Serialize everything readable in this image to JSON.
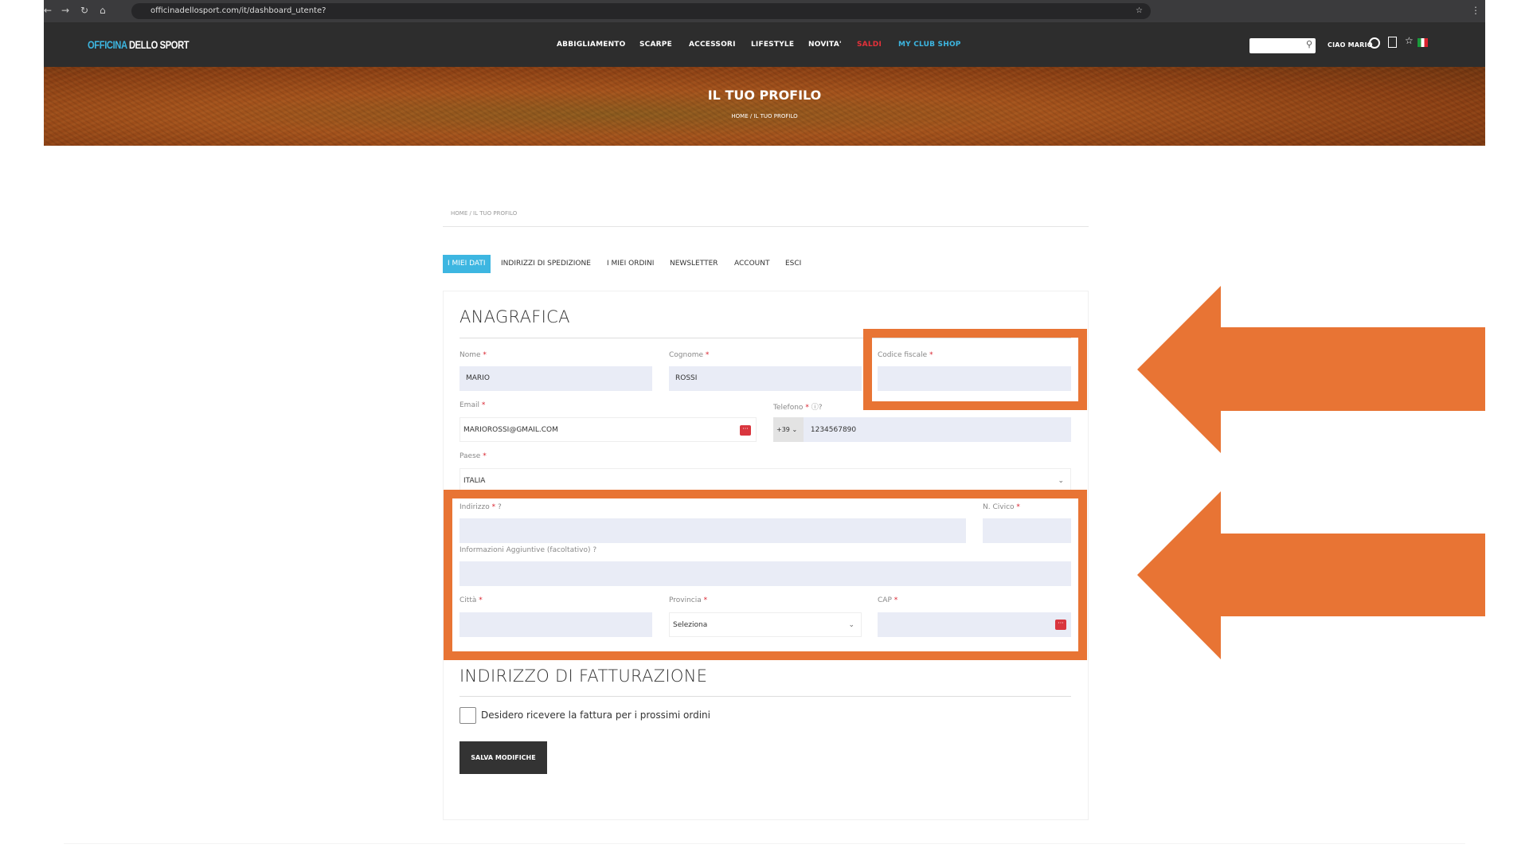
{
  "browser": {
    "url": "officinadellosport.com/it/dashboard_utente?"
  },
  "header": {
    "logo_part1": "OFFICINA",
    "logo_part2": "DELLO SPORT",
    "nav": [
      "ABBIGLIAMENTO",
      "SCARPE",
      "ACCESSORI",
      "LIFESTYLE",
      "NOVITA'",
      "SALDI",
      "MY CLUB SHOP"
    ],
    "greeting": "CIAO MARIO"
  },
  "banner": {
    "title": "IL TUO PROFILO",
    "breadcrumb": "HOME /  IL TUO PROFILO"
  },
  "breadcrumb": "HOME / IL TUO PROFILO",
  "tabs": [
    "I MIEI DATI",
    "INDIRIZZI DI SPEDIZIONE",
    "I MIEI ORDINI",
    "NEWSLETTER",
    "ACCOUNT",
    "ESCI"
  ],
  "form": {
    "section1": "ANAGRAFICA",
    "nome": {
      "label": "Nome",
      "value": "MARIO"
    },
    "cognome": {
      "label": "Cognome",
      "value": "ROSSI"
    },
    "codice_fiscale": {
      "label": "Codice fiscale",
      "value": ""
    },
    "email": {
      "label": "Email",
      "value": "MARIOROSSI@GMAIL.COM"
    },
    "telefono": {
      "label": "Telefono",
      "prefix": "+39",
      "value": "1234567890"
    },
    "paese": {
      "label": "Paese",
      "value": "ITALIA"
    },
    "indirizzo": {
      "label": "Indirizzo",
      "value": ""
    },
    "civico": {
      "label": "N. Civico",
      "value": ""
    },
    "info": {
      "label": "Informazioni Aggiuntive (facoltativo)",
      "value": ""
    },
    "citta": {
      "label": "Città",
      "value": ""
    },
    "provincia": {
      "label": "Provincia",
      "value": "Seleziona"
    },
    "cap": {
      "label": "CAP",
      "value": ""
    },
    "section2": "INDIRIZZO DI FATTURAZIONE",
    "invoice_checkbox": "Desidero ricevere la fattura per i prossimi ordini",
    "invoice_checked": false,
    "save": "SALVA MODIFICHE"
  },
  "colors": {
    "annotation": "#e87434",
    "accent": "#3db6e1",
    "sale": "#e5313a"
  }
}
